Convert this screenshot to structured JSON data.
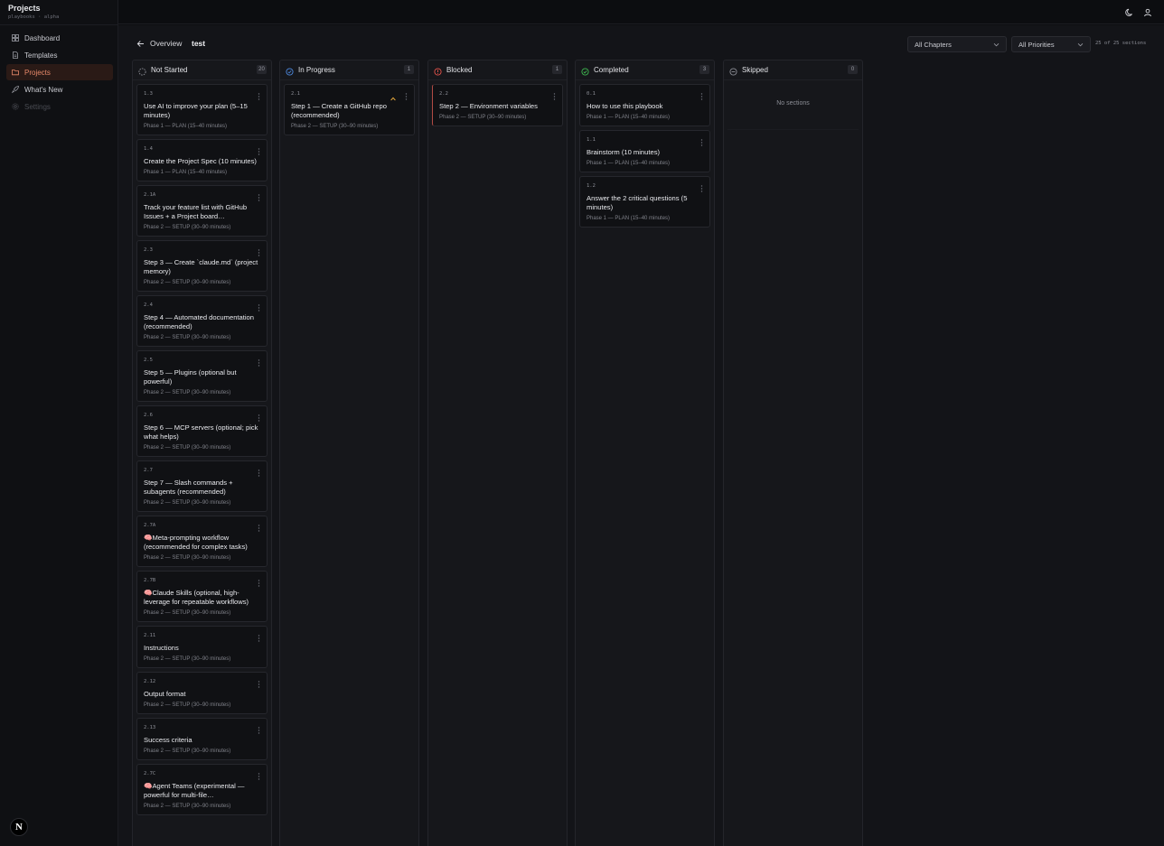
{
  "app": {
    "title": "Projects",
    "subtitle": "playbooks · alpha"
  },
  "sidebar": {
    "items": [
      {
        "label": "Dashboard",
        "icon": "dashboard-icon"
      },
      {
        "label": "Templates",
        "icon": "document-icon"
      },
      {
        "label": "Projects",
        "icon": "folder-icon",
        "active": true
      },
      {
        "label": "What's New",
        "icon": "rocket-icon"
      },
      {
        "label": "Settings",
        "icon": "gear-icon",
        "disabled": true
      }
    ],
    "logo": "N"
  },
  "header": {
    "back_label": "Overview",
    "project_name": "test",
    "chapter_filter": "All Chapters",
    "priority_filter": "All Priorities",
    "section_count": "25 of 25 sections"
  },
  "colors": {
    "accent": "#e8896a",
    "blocked": "#e5534b",
    "completed": "#3fb950",
    "in_progress": "#4e8ae0",
    "priority": "#e0a43a"
  },
  "columns": [
    {
      "title": "Not Started",
      "count": "20",
      "icon": "circle-dashed-icon",
      "cards": [
        {
          "num": "1.3",
          "title": "Use AI to improve your plan (5–15 minutes)",
          "phase": "Phase 1 — PLAN (15–40 minutes)"
        },
        {
          "num": "1.4",
          "title": "Create the Project Spec (10 minutes)",
          "phase": "Phase 1 — PLAN (15–40 minutes)"
        },
        {
          "num": "2.1A",
          "title": "Track your feature list with GitHub Issues + a Project board…",
          "phase": "Phase 2 — SETUP (30–90 minutes)"
        },
        {
          "num": "2.3",
          "title": "Step 3 — Create `claude.md` (project memory)",
          "phase": "Phase 2 — SETUP (30–90 minutes)"
        },
        {
          "num": "2.4",
          "title": "Step 4 — Automated documentation (recommended)",
          "phase": "Phase 2 — SETUP (30–90 minutes)"
        },
        {
          "num": "2.5",
          "title": "Step 5 — Plugins (optional but powerful)",
          "phase": "Phase 2 — SETUP (30–90 minutes)"
        },
        {
          "num": "2.6",
          "title": "Step 6 — MCP servers (optional; pick what helps)",
          "phase": "Phase 2 — SETUP (30–90 minutes)"
        },
        {
          "num": "2.7",
          "title": "Step 7 — Slash commands + subagents (recommended)",
          "phase": "Phase 2 — SETUP (30–90 minutes)"
        },
        {
          "num": "2.7A",
          "title": "🧠Meta-prompting workflow (recommended for complex tasks)",
          "phase": "Phase 2 — SETUP (30–90 minutes)"
        },
        {
          "num": "2.7B",
          "title": "🧠Claude Skills (optional, high-leverage for repeatable workflows)",
          "phase": "Phase 2 — SETUP (30–90 minutes)"
        },
        {
          "num": "2.11",
          "title": "Instructions",
          "phase": "Phase 2 — SETUP (30–90 minutes)"
        },
        {
          "num": "2.12",
          "title": "Output format",
          "phase": "Phase 2 — SETUP (30–90 minutes)"
        },
        {
          "num": "2.13",
          "title": "Success criteria",
          "phase": "Phase 2 — SETUP (30–90 minutes)"
        },
        {
          "num": "2.7C",
          "title": "🧠Agent Teams (experimental — powerful for multi-file…",
          "phase": "Phase 2 — SETUP (30–90 minutes)"
        }
      ]
    },
    {
      "title": "In Progress",
      "count": "1",
      "icon": "circle-progress-icon",
      "cards": [
        {
          "num": "2.1",
          "title": "Step 1 — Create a GitHub repo (recommended)",
          "phase": "Phase 2 — SETUP (30–90 minutes)",
          "priority": true
        }
      ]
    },
    {
      "title": "Blocked",
      "count": "1",
      "icon": "alert-circle-icon",
      "cards": [
        {
          "num": "2.2",
          "title": "Step 2 — Environment variables",
          "phase": "Phase 2 — SETUP (30–90 minutes)",
          "blocked": true
        }
      ]
    },
    {
      "title": "Completed",
      "count": "3",
      "icon": "check-circle-icon",
      "cards": [
        {
          "num": "0.1",
          "title": "How to use this playbook",
          "phase": "Phase 1 — PLAN (15–40 minutes)"
        },
        {
          "num": "1.1",
          "title": "Brainstorm (10 minutes)",
          "phase": "Phase 1 — PLAN (15–40 minutes)"
        },
        {
          "num": "1.2",
          "title": "Answer the 2 critical questions (5 minutes)",
          "phase": "Phase 1 — PLAN (15–40 minutes)"
        }
      ]
    },
    {
      "title": "Skipped",
      "count": "0",
      "icon": "minus-circle-icon",
      "empty_text": "No sections",
      "cards": []
    }
  ]
}
